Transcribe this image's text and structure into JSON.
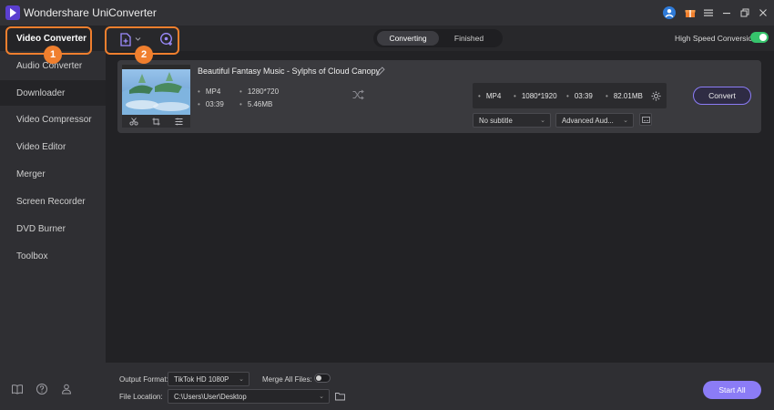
{
  "window": {
    "title": "Wondershare UniConverter"
  },
  "sidebar": {
    "items": [
      {
        "label": "Video Converter"
      },
      {
        "label": "Audio Converter"
      },
      {
        "label": "Downloader"
      },
      {
        "label": "Video Compressor"
      },
      {
        "label": "Video Editor"
      },
      {
        "label": "Merger"
      },
      {
        "label": "Screen Recorder"
      },
      {
        "label": "DVD Burner"
      },
      {
        "label": "Toolbox"
      }
    ]
  },
  "annotations": {
    "one": "1",
    "two": "2"
  },
  "toolbar": {
    "tab_converting": "Converting",
    "tab_finished": "Finished",
    "high_speed_label": "High Speed Conversion"
  },
  "file": {
    "title": "Beautiful Fantasy Music - Sylphs of Cloud Canopy",
    "format": "MP4",
    "resolution": "1280*720",
    "duration": "03:39",
    "size": "5.46MB"
  },
  "target": {
    "format": "MP4",
    "resolution": "1080*1920",
    "duration": "03:39",
    "size": "82.01MB"
  },
  "actions": {
    "convert": "Convert",
    "start_all": "Start All"
  },
  "dropdowns": {
    "subtitle": "No subtitle",
    "audio": "Advanced Aud..."
  },
  "bottom": {
    "output_format_label": "Output Format:",
    "output_format_value": "TikTok HD 1080P",
    "merge_label": "Merge All Files:",
    "file_location_label": "File Location:",
    "file_location_value": "C:\\Users\\User\\Desktop"
  },
  "colors": {
    "accent": "#8b7cf6",
    "highlight": "#f07f2e",
    "toggle_on": "#36c46c"
  }
}
